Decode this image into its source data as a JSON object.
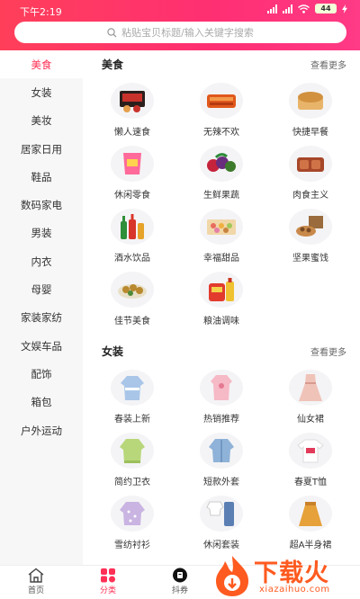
{
  "status_bar": {
    "time": "下午2:19",
    "battery": "44"
  },
  "search": {
    "placeholder": "粘贴宝贝标题/输入关键字搜索"
  },
  "sidebar": {
    "items": [
      {
        "label": "美食",
        "active": true
      },
      {
        "label": "女装"
      },
      {
        "label": "美妆"
      },
      {
        "label": "居家日用"
      },
      {
        "label": "鞋品"
      },
      {
        "label": "数码家电"
      },
      {
        "label": "男装"
      },
      {
        "label": "内衣"
      },
      {
        "label": "母婴"
      },
      {
        "label": "家装家纺"
      },
      {
        "label": "文娱车品"
      },
      {
        "label": "配饰"
      },
      {
        "label": "箱包"
      },
      {
        "label": "户外运动"
      }
    ]
  },
  "sections": [
    {
      "title": "美食",
      "more": "查看更多",
      "items": [
        {
          "label": "懒人速食",
          "icon": "instant-noodles-icon"
        },
        {
          "label": "无辣不欢",
          "icon": "spicy-food-icon"
        },
        {
          "label": "快捷早餐",
          "icon": "bread-icon"
        },
        {
          "label": "休闲零食",
          "icon": "snack-bag-icon"
        },
        {
          "label": "生鲜果蔬",
          "icon": "fruit-icon"
        },
        {
          "label": "肉食主义",
          "icon": "meat-icon"
        },
        {
          "label": "酒水饮品",
          "icon": "drink-bottles-icon"
        },
        {
          "label": "幸福甜品",
          "icon": "dessert-icon"
        },
        {
          "label": "坚果蜜饯",
          "icon": "nuts-icon"
        },
        {
          "label": "佳节美食",
          "icon": "festival-food-icon"
        },
        {
          "label": "粮油调味",
          "icon": "grain-oil-icon"
        }
      ]
    },
    {
      "title": "女装",
      "more": "查看更多",
      "items": [
        {
          "label": "春装上新",
          "icon": "blouse-icon"
        },
        {
          "label": "热销推荐",
          "icon": "pink-top-icon"
        },
        {
          "label": "仙女裙",
          "icon": "dress-icon"
        },
        {
          "label": "简约卫衣",
          "icon": "sweatshirt-icon"
        },
        {
          "label": "短款外套",
          "icon": "denim-jacket-icon"
        },
        {
          "label": "春夏T恤",
          "icon": "tshirt-icon"
        },
        {
          "label": "雪纺衬衫",
          "icon": "chiffon-shirt-icon"
        },
        {
          "label": "休闲套装",
          "icon": "casual-set-icon"
        },
        {
          "label": "超A半身裙",
          "icon": "skirt-icon"
        }
      ]
    }
  ],
  "bottom_nav": [
    {
      "label": "首页",
      "icon": "home-icon"
    },
    {
      "label": "分类",
      "icon": "category-icon",
      "active": true
    },
    {
      "label": "抖券",
      "icon": "coupon-icon"
    }
  ],
  "watermark": {
    "text": "下载火",
    "url": "xiazaihuo.com"
  },
  "colors": {
    "accent": "#ff2f55",
    "header": "#ff3a6a",
    "watermark": "#ff5a1f"
  }
}
